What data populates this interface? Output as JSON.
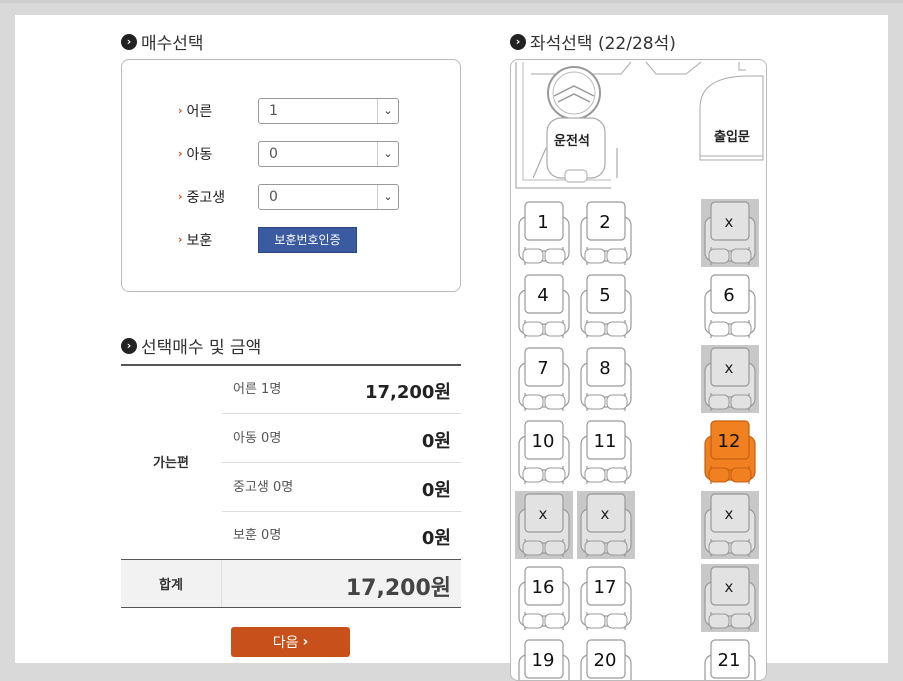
{
  "ticket_count": {
    "title": "매수선택",
    "rows": [
      {
        "label": "어른",
        "value": "1"
      },
      {
        "label": "아동",
        "value": "0"
      },
      {
        "label": "중고생",
        "value": "0"
      }
    ],
    "veteran_label": "보훈",
    "veteran_button": "보훈번호인증"
  },
  "summary": {
    "title": "선택매수 및 금액",
    "route_label": "가는편",
    "rows": [
      {
        "name": "어른 1명",
        "price": "17,200원"
      },
      {
        "name": "아동 0명",
        "price": "0원"
      },
      {
        "name": "중고생 0명",
        "price": "0원"
      },
      {
        "name": "보훈 0명",
        "price": "0원"
      }
    ],
    "total_label": "합계",
    "total": "17,200원"
  },
  "next_button": "다음",
  "seats": {
    "title": "좌석선택 (22/28석)",
    "driver_label": "운전석",
    "door_label": "출입문",
    "grid": [
      {
        "num": "1",
        "state": "available"
      },
      {
        "num": "2",
        "state": "available"
      },
      {
        "num": "x",
        "state": "taken"
      },
      {
        "num": "4",
        "state": "available"
      },
      {
        "num": "5",
        "state": "available"
      },
      {
        "num": "6",
        "state": "available"
      },
      {
        "num": "7",
        "state": "available"
      },
      {
        "num": "8",
        "state": "available"
      },
      {
        "num": "x",
        "state": "taken"
      },
      {
        "num": "10",
        "state": "available"
      },
      {
        "num": "11",
        "state": "available"
      },
      {
        "num": "12",
        "state": "selected"
      },
      {
        "num": "x",
        "state": "taken"
      },
      {
        "num": "x",
        "state": "taken"
      },
      {
        "num": "x",
        "state": "taken"
      },
      {
        "num": "16",
        "state": "available"
      },
      {
        "num": "17",
        "state": "available"
      },
      {
        "num": "x",
        "state": "taken"
      },
      {
        "num": "19",
        "state": "available"
      },
      {
        "num": "20",
        "state": "available"
      },
      {
        "num": "21",
        "state": "available"
      }
    ],
    "colors": {
      "selected": "#f08020",
      "taken": "#c8c8c8",
      "available": "#ffffff"
    }
  }
}
